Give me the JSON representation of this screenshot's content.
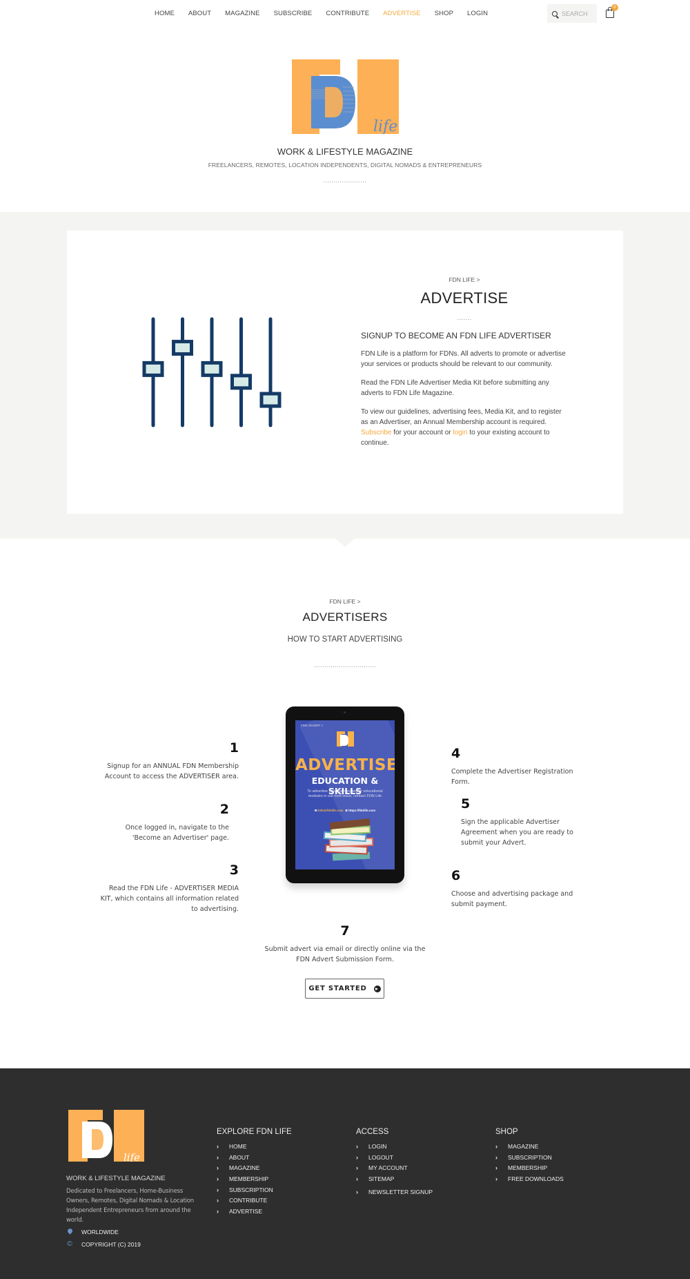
{
  "nav": {
    "items": [
      {
        "label": "HOME",
        "active": false
      },
      {
        "label": "ABOUT",
        "active": false
      },
      {
        "label": "MAGAZINE",
        "active": false
      },
      {
        "label": "SUBSCRIBE",
        "active": false
      },
      {
        "label": "CONTRIBUTE",
        "active": false
      },
      {
        "label": "ADVERTISE",
        "active": true
      },
      {
        "label": "SHOP",
        "active": false
      },
      {
        "label": "LOGIN",
        "active": false
      }
    ],
    "search_placeholder": "SEARCH",
    "cart_count": "0",
    "accent_color": "#f4a93c"
  },
  "header": {
    "logo_text": "FDN",
    "logo_script": "life",
    "title": "WORK & LIFESTYLE MAGAZINE",
    "subtitle": "FREELANCERS, REMOTES, LOCATION INDEPENDENTS, DIGITAL NOMADS & ENTREPRENEURS",
    "divider": "....................."
  },
  "advertise": {
    "breadcrumb": "FDN LIFE >",
    "title": "ADVERTISE",
    "divider": ".......",
    "subtitle": "SIGNUP TO BECOME AN FDN LIFE ADVERTISER",
    "p1": "FDN Life is a platform for FDNs. All adverts to promote or advertise your services or products should be relevant to our community.",
    "p2": "Read the FDN Life Advertiser Media Kit before submitting any adverts to FDN Life Magazine.",
    "p3_before": "To view our guidelines, advertising fees, Media Kit, and to register as an Advertiser, an Annual Membership account is required. ",
    "p3_link1": "Subscribe",
    "p3_middle": " for your  account or ",
    "p3_link2": "login",
    "p3_after": " to your existing account to continue.",
    "slider_levels": [
      0.47,
      0.27,
      0.47,
      0.59,
      0.76
    ]
  },
  "advertisers": {
    "breadcrumb": "FDN LIFE >",
    "title": "ADVERTISERS",
    "subtitle": "HOW TO START ADVERTISING",
    "divider": "..............................",
    "steps": [
      {
        "num": "1",
        "text": "Signup for an ANNUAL FDN Membership Account to access the ADVERTISER area."
      },
      {
        "num": "2",
        "text": "Once logged in, navigate to the 'Become an Advertiser' page."
      },
      {
        "num": "3",
        "text": "Read the FDN Life - ADVERTISER MEDIA KIT, which contains all information related to advertising."
      },
      {
        "num": "4",
        "text": "Complete the Advertiser Registration Form."
      },
      {
        "num": "5",
        "text": "Sign the applicable Advertiser Agreement when you are ready to submit your Advert."
      },
      {
        "num": "6",
        "text": "Choose and advertising package and submit payment."
      },
      {
        "num": "7",
        "text": "Submit advert via email or directly online via the FDN Advert Submission Form."
      }
    ],
    "tablet": {
      "crumb": "FDN ADVERT >",
      "headline": "ADVERTISE",
      "subhead": "EDUCATION & SKILLS",
      "body": "To advertise your courses and/or educational modules in our next issue, contact FDN Life",
      "email": "info@fdnlife.com",
      "url": "https://fdnlife.com"
    },
    "cta_label": "GET STARTED"
  },
  "footer": {
    "tagline": "WORK & LIFESTYLE MAGAZINE",
    "description": "Dedicated to Freelancers, Home-Business Owners, Remotes, Digital Nomads & Location Independent Entrepreneurs from around the world.",
    "location": "WORLDWIDE",
    "copyright": "COPYRIGHT (C) 2019",
    "columns": [
      {
        "title": "EXPLORE FDN LIFE",
        "items": [
          "HOME",
          "ABOUT",
          "MAGAZINE",
          "MEMBERSHIP",
          "SUBSCRIPTION",
          "CONTRIBUTE",
          "ADVERTISE"
        ]
      },
      {
        "title": "ACCESS",
        "items": [
          "LOGIN",
          "LOGOUT",
          "MY ACCOUNT",
          "SITEMAP",
          "NEWSLETTER SIGNUP"
        ]
      },
      {
        "title": "SHOP",
        "items": [
          "MAGAZINE",
          "SUBSCRIPTION",
          "MEMBERSHIP",
          "FREE DOWNLOADS"
        ]
      }
    ]
  }
}
